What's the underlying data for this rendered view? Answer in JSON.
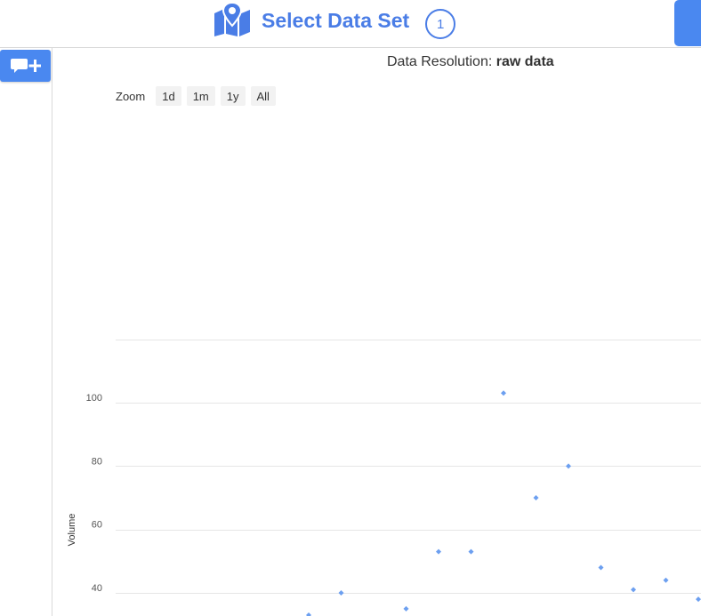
{
  "header": {
    "title": "Select Data Set",
    "step_number": "1",
    "icon": "map-marker-icon",
    "accent_color": "#4a7de6"
  },
  "sidebar": {
    "add_comment_icon": "comment-plus-icon",
    "button_color": "#4a88f0"
  },
  "resolution": {
    "label": "Data Resolution:",
    "value": "raw data"
  },
  "zoom": {
    "label": "Zoom",
    "buttons": [
      "1d",
      "1m",
      "1y",
      "All"
    ]
  },
  "chart_data": {
    "type": "scatter",
    "ylabel": "Volume",
    "yticks": [
      40,
      60,
      80,
      100
    ],
    "ylim": [
      33,
      120
    ],
    "xlim": [
      0,
      18
    ],
    "grid": true,
    "marker_color": "#6c9ff0",
    "points": [
      {
        "x": 6,
        "y": 33
      },
      {
        "x": 7,
        "y": 40
      },
      {
        "x": 9,
        "y": 35
      },
      {
        "x": 10,
        "y": 53
      },
      {
        "x": 11,
        "y": 53
      },
      {
        "x": 12,
        "y": 103
      },
      {
        "x": 13,
        "y": 70
      },
      {
        "x": 14,
        "y": 80
      },
      {
        "x": 15,
        "y": 48
      },
      {
        "x": 16,
        "y": 41
      },
      {
        "x": 17,
        "y": 44
      },
      {
        "x": 18,
        "y": 38
      }
    ]
  }
}
